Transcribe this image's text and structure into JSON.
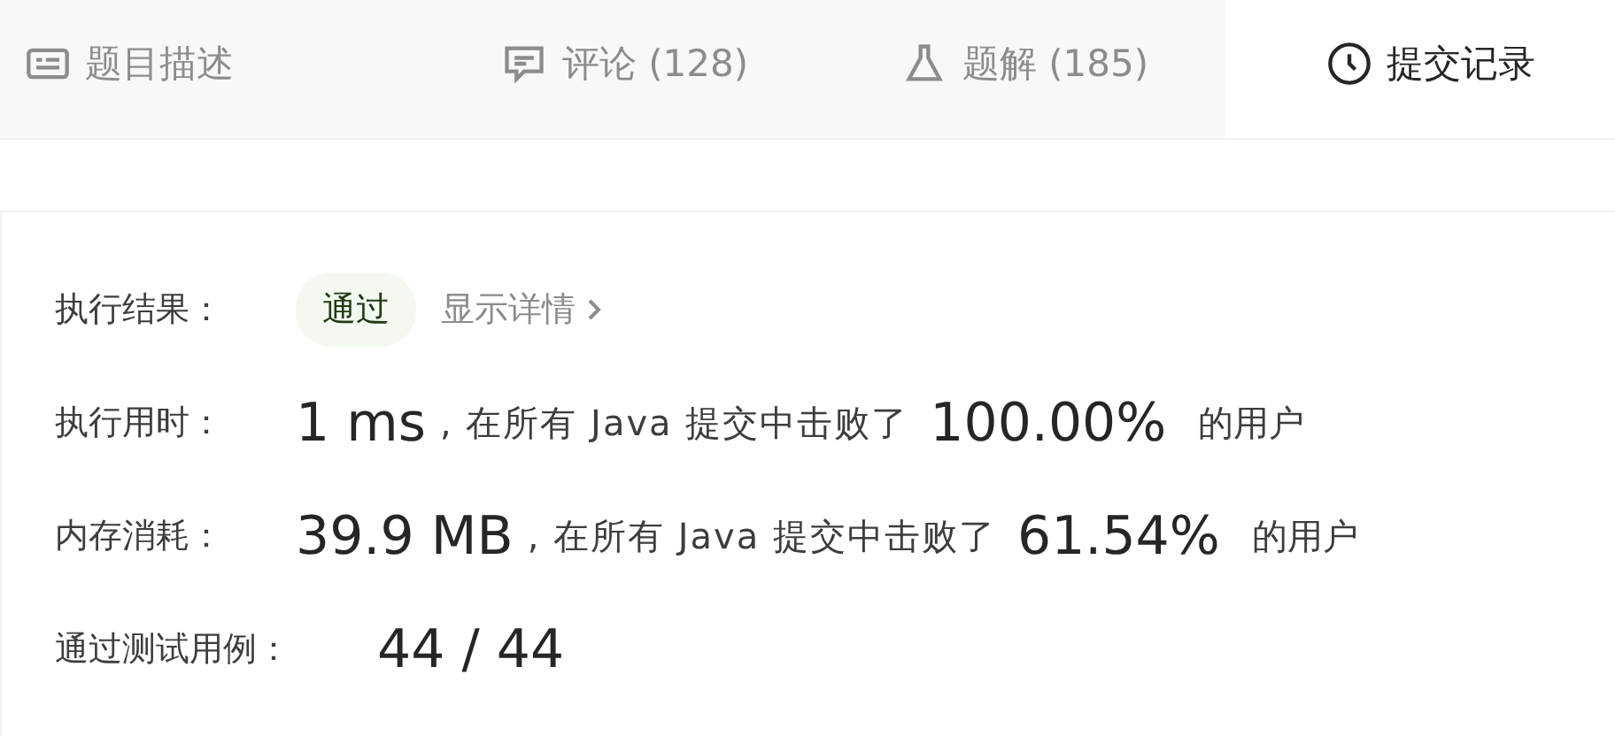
{
  "tabs": [
    {
      "label": "题目描述",
      "kind": "description",
      "selected": false
    },
    {
      "label": "评论 (128)",
      "kind": "comment",
      "selected": false
    },
    {
      "label": "题解 (185)",
      "kind": "flask",
      "selected": false
    },
    {
      "label": "提交记录",
      "kind": "clock",
      "selected": true
    }
  ],
  "result": {
    "label": "执行结果：",
    "status": "通过",
    "details_link": "显示详情"
  },
  "stats": [
    {
      "label": "执行用时：",
      "value": "1 ms",
      "text": ", 在所有 Java 提交中击败了",
      "percent": "100.00%",
      "suffix": "的用户"
    },
    {
      "label": "内存消耗：",
      "value": "39.9 MB",
      "text": ", 在所有 Java 提交中击败了",
      "percent": "61.54%",
      "suffix": "的用户"
    }
  ],
  "tests": {
    "label": "通过测试用例：",
    "value": "44 / 44"
  }
}
